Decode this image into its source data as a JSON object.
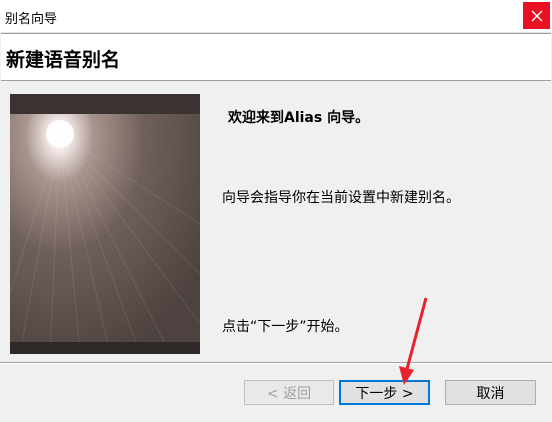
{
  "window": {
    "title": "别名向导"
  },
  "header": {
    "title": "新建语音别名"
  },
  "content": {
    "welcome": "欢迎来到Alias 向导。",
    "description": "向导会指导你在当前设置中新建别名。",
    "start_hint": "点击“下一步”开始。"
  },
  "buttons": {
    "back": "< 返回",
    "next": "下一步 >",
    "cancel": "取消"
  },
  "colors": {
    "close": "#e81123",
    "focus": "#0078d7",
    "annotation": "#e8212e"
  }
}
